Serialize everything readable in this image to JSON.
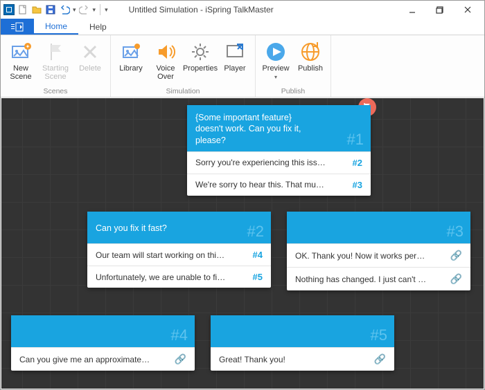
{
  "window": {
    "title": "Untitled Simulation - iSpring TalkMaster"
  },
  "tabs": {
    "home": "Home",
    "help": "Help"
  },
  "ribbon": {
    "groups": {
      "scenes": {
        "label": "Scenes",
        "new_scene": "New\nScene",
        "starting_scene": "Starting\nScene",
        "delete": "Delete"
      },
      "simulation": {
        "label": "Simulation",
        "library": "Library",
        "voice_over": "Voice\nOver",
        "properties": "Properties",
        "player": "Player"
      },
      "publish": {
        "label": "Publish",
        "preview": "Preview",
        "publish": "Publish"
      }
    }
  },
  "nodes": {
    "n1": {
      "num": "#1",
      "question": "{Some important feature} doesn't work. Can you fix it, please?",
      "answers": [
        {
          "text": "Sorry you're experiencing this issue. We ...",
          "tag": "#2"
        },
        {
          "text": "We're sorry to hear this. That must be v...",
          "tag": "#3"
        }
      ]
    },
    "n2": {
      "num": "#2",
      "question": "Can you fix it fast?",
      "answers": [
        {
          "text": "Our team will start working on this pro...",
          "tag": "#4"
        },
        {
          "text": "Unfortunately, we are unable to fix it rig...",
          "tag": "#5"
        }
      ]
    },
    "n3": {
      "num": "#3",
      "question": "",
      "answers": [
        {
          "text": "OK. Thank you! Now it works perfectly."
        },
        {
          "text": "Nothing has changed. I just can't believ..."
        }
      ]
    },
    "n4": {
      "num": "#4",
      "question": "",
      "answers": [
        {
          "text": "Can you give me an approximate date ..."
        }
      ]
    },
    "n5": {
      "num": "#5",
      "question": "",
      "answers": [
        {
          "text": "Great! Thank you!"
        }
      ]
    }
  }
}
